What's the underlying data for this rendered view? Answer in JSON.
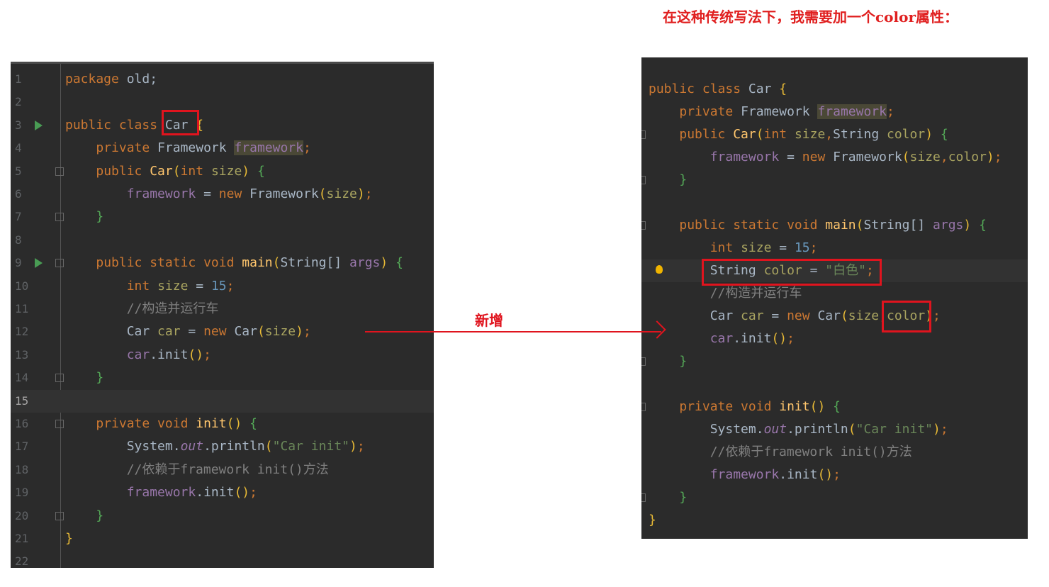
{
  "annotation": {
    "title": "在这种传统写法下，我需要加一个color属性：",
    "arrow_label": "新增",
    "accent": "#e0141e"
  },
  "left_editor": {
    "current_line": 15,
    "lines": [
      [
        [
          "k",
          "package "
        ],
        [
          "p",
          "old;"
        ]
      ],
      [],
      [
        [
          "k",
          "public class "
        ],
        [
          "p",
          "Car "
        ],
        [
          "b1",
          "{"
        ]
      ],
      [
        [
          "p",
          "    "
        ],
        [
          "k",
          "private "
        ],
        [
          "p",
          "Framework "
        ],
        [
          "f hl",
          "framework"
        ],
        [
          "k",
          ";"
        ]
      ],
      [
        [
          "p",
          "    "
        ],
        [
          "k",
          "public "
        ],
        [
          "m",
          "Car"
        ],
        [
          "b1",
          "("
        ],
        [
          "k",
          "int "
        ],
        [
          "v",
          "size"
        ],
        [
          "b1",
          ")"
        ],
        [
          "p",
          " "
        ],
        [
          "b2",
          "{"
        ]
      ],
      [
        [
          "p",
          "        "
        ],
        [
          "f",
          "framework"
        ],
        [
          "p",
          " = "
        ],
        [
          "k",
          "new "
        ],
        [
          "p",
          "Framework"
        ],
        [
          "b1",
          "("
        ],
        [
          "v",
          "size"
        ],
        [
          "b1",
          ")"
        ],
        [
          "k",
          ";"
        ]
      ],
      [
        [
          "p",
          "    "
        ],
        [
          "b2",
          "}"
        ]
      ],
      [],
      [
        [
          "p",
          "    "
        ],
        [
          "k",
          "public static void "
        ],
        [
          "m",
          "main"
        ],
        [
          "b1",
          "("
        ],
        [
          "p",
          "String[] "
        ],
        [
          "f",
          "args"
        ],
        [
          "b1",
          ")"
        ],
        [
          "p",
          " "
        ],
        [
          "b2",
          "{"
        ]
      ],
      [
        [
          "p",
          "        "
        ],
        [
          "k",
          "int "
        ],
        [
          "v",
          "size"
        ],
        [
          "p",
          " = "
        ],
        [
          "n",
          "15"
        ],
        [
          "k",
          ";"
        ]
      ],
      [
        [
          "p",
          "        "
        ],
        [
          "c",
          "//构造并运行车"
        ]
      ],
      [
        [
          "p",
          "        Car "
        ],
        [
          "v",
          "car"
        ],
        [
          "p",
          " = "
        ],
        [
          "k",
          "new "
        ],
        [
          "p",
          "Car"
        ],
        [
          "b1",
          "("
        ],
        [
          "v",
          "size"
        ],
        [
          "b1",
          ")"
        ],
        [
          "k",
          ";"
        ]
      ],
      [
        [
          "p",
          "        "
        ],
        [
          "f",
          "car"
        ],
        [
          "p",
          ".init"
        ],
        [
          "b1",
          "()"
        ],
        [
          "k",
          ";"
        ]
      ],
      [
        [
          "p",
          "    "
        ],
        [
          "b2",
          "}"
        ]
      ],
      [],
      [
        [
          "p",
          "    "
        ],
        [
          "k",
          "private void "
        ],
        [
          "m",
          "init"
        ],
        [
          "b1",
          "()"
        ],
        [
          "p",
          " "
        ],
        [
          "b2",
          "{"
        ]
      ],
      [
        [
          "p",
          "        System."
        ],
        [
          "i",
          "out"
        ],
        [
          "p",
          ".println"
        ],
        [
          "b1",
          "("
        ],
        [
          "s",
          "\"Car init\""
        ],
        [
          "b1",
          ")"
        ],
        [
          "k",
          ";"
        ]
      ],
      [
        [
          "p",
          "        "
        ],
        [
          "c",
          "//依赖于framework init()方法"
        ]
      ],
      [
        [
          "p",
          "        "
        ],
        [
          "f",
          "framework"
        ],
        [
          "p",
          ".init"
        ],
        [
          "b1",
          "()"
        ],
        [
          "k",
          ";"
        ]
      ],
      [
        [
          "p",
          "    "
        ],
        [
          "b2",
          "}"
        ]
      ],
      [
        [
          "b1",
          "}"
        ]
      ],
      []
    ]
  },
  "right_editor": {
    "current_line": 9,
    "lines": [
      [
        [
          "k",
          "public class "
        ],
        [
          "p",
          "Car "
        ],
        [
          "b1",
          "{"
        ]
      ],
      [
        [
          "p",
          "    "
        ],
        [
          "k",
          "private "
        ],
        [
          "p",
          "Framework "
        ],
        [
          "f hl",
          "framework"
        ],
        [
          "k",
          ";"
        ]
      ],
      [
        [
          "p",
          "    "
        ],
        [
          "k",
          "public "
        ],
        [
          "m",
          "Car"
        ],
        [
          "b1",
          "("
        ],
        [
          "k",
          "int "
        ],
        [
          "v",
          "size"
        ],
        [
          "k",
          ","
        ],
        [
          "p",
          "String "
        ],
        [
          "v",
          "color"
        ],
        [
          "b1",
          ")"
        ],
        [
          "p",
          " "
        ],
        [
          "b2",
          "{"
        ]
      ],
      [
        [
          "p",
          "        "
        ],
        [
          "f",
          "framework"
        ],
        [
          "p",
          " = "
        ],
        [
          "k",
          "new "
        ],
        [
          "p",
          "Framework"
        ],
        [
          "b1",
          "("
        ],
        [
          "v",
          "size"
        ],
        [
          "k",
          ","
        ],
        [
          "v",
          "color"
        ],
        [
          "b1",
          ")"
        ],
        [
          "k",
          ";"
        ]
      ],
      [
        [
          "p",
          "    "
        ],
        [
          "b2",
          "}"
        ]
      ],
      [],
      [
        [
          "p",
          "    "
        ],
        [
          "k",
          "public static void "
        ],
        [
          "m",
          "main"
        ],
        [
          "b1",
          "("
        ],
        [
          "p",
          "String[] "
        ],
        [
          "f",
          "args"
        ],
        [
          "b1",
          ")"
        ],
        [
          "p",
          " "
        ],
        [
          "b2",
          "{"
        ]
      ],
      [
        [
          "p",
          "        "
        ],
        [
          "k",
          "int "
        ],
        [
          "v",
          "size"
        ],
        [
          "p",
          " = "
        ],
        [
          "n",
          "15"
        ],
        [
          "k",
          ";"
        ]
      ],
      [
        [
          "p",
          "        String "
        ],
        [
          "v",
          "color"
        ],
        [
          "p",
          " = "
        ],
        [
          "s",
          "\"白色\""
        ],
        [
          "k",
          ";"
        ]
      ],
      [
        [
          "p",
          "        "
        ],
        [
          "c",
          "//构造并运行车"
        ]
      ],
      [
        [
          "p",
          "        Car "
        ],
        [
          "v",
          "car"
        ],
        [
          "p",
          " = "
        ],
        [
          "k",
          "new "
        ],
        [
          "p",
          "Car"
        ],
        [
          "b1",
          "("
        ],
        [
          "v",
          "size"
        ],
        [
          "k",
          ","
        ],
        [
          "v",
          "color"
        ],
        [
          "b1",
          ")"
        ],
        [
          "k",
          ";"
        ]
      ],
      [
        [
          "p",
          "        "
        ],
        [
          "f",
          "car"
        ],
        [
          "p",
          ".init"
        ],
        [
          "b1",
          "()"
        ],
        [
          "k",
          ";"
        ]
      ],
      [
        [
          "p",
          "    "
        ],
        [
          "b2",
          "}"
        ]
      ],
      [],
      [
        [
          "p",
          "    "
        ],
        [
          "k",
          "private void "
        ],
        [
          "m",
          "init"
        ],
        [
          "b1",
          "()"
        ],
        [
          "p",
          " "
        ],
        [
          "b2",
          "{"
        ]
      ],
      [
        [
          "p",
          "        System."
        ],
        [
          "i",
          "out"
        ],
        [
          "p",
          ".println"
        ],
        [
          "b1",
          "("
        ],
        [
          "s",
          "\"Car init\""
        ],
        [
          "b1",
          ")"
        ],
        [
          "k",
          ";"
        ]
      ],
      [
        [
          "p",
          "        "
        ],
        [
          "c",
          "//依赖于framework init()方法"
        ]
      ],
      [
        [
          "p",
          "        "
        ],
        [
          "f",
          "framework"
        ],
        [
          "p",
          ".init"
        ],
        [
          "b1",
          "()"
        ],
        [
          "k",
          ";"
        ]
      ],
      [
        [
          "p",
          "    "
        ],
        [
          "b2",
          "}"
        ]
      ],
      [
        [
          "b1",
          "}"
        ]
      ]
    ]
  }
}
